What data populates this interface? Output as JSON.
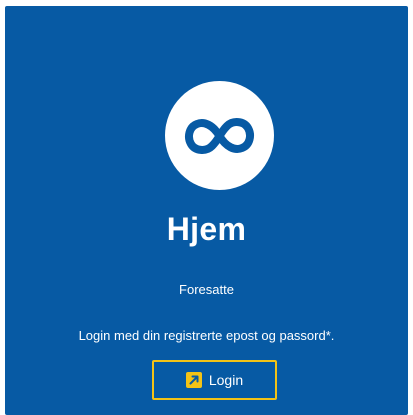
{
  "colors": {
    "card_background": "#075aa4",
    "accent": "#f3c316",
    "text": "#ffffff"
  },
  "logo": {
    "icon": "infinity-icon"
  },
  "header": {
    "title": "Hjem",
    "subtitle": "Foresatte"
  },
  "info": {
    "text": "Login med din registrerte epost og passord*."
  },
  "login_button": {
    "label": "Login",
    "icon": "login-arrow-icon"
  }
}
